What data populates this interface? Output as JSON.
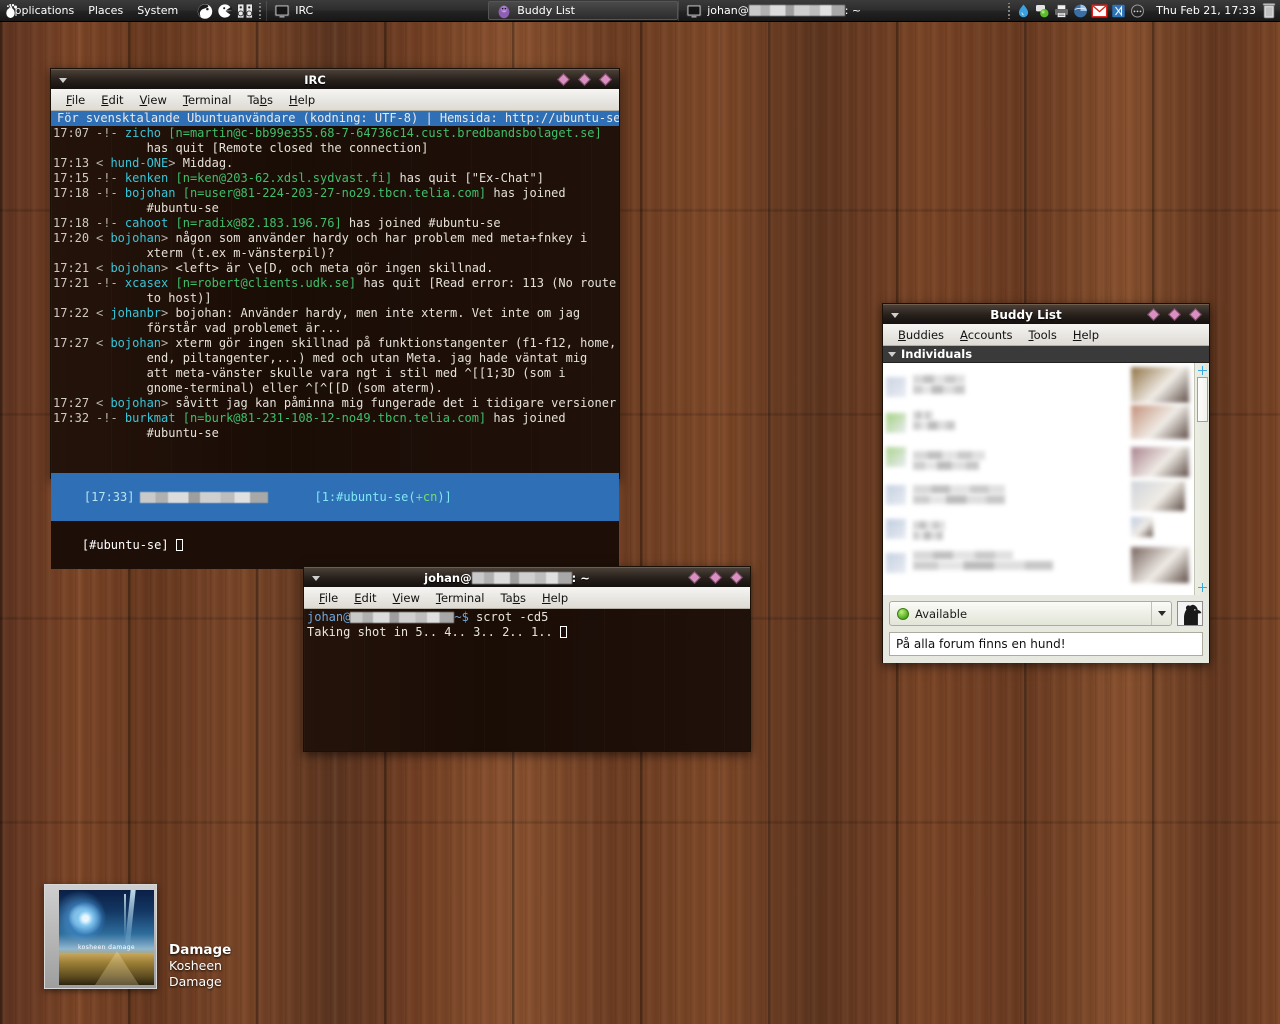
{
  "panel": {
    "foot_icon": "gnome-foot-icon",
    "menus": [
      "Applications",
      "Places",
      "System"
    ],
    "launchers": [
      {
        "name": "firefox-icon"
      },
      {
        "name": "pidgin-icon"
      },
      {
        "name": "volume-control-icon"
      }
    ],
    "tasks": [
      {
        "name": "task-irc",
        "icon": "terminal-icon",
        "label": "IRC",
        "active": false
      },
      {
        "name": "task-buddy-list",
        "icon": "pidgin-icon",
        "label": "Buddy List",
        "active": true
      },
      {
        "name": "task-terminal",
        "icon": "terminal-icon",
        "label": "johan@",
        "label_suffix": ": ~",
        "redacted": true,
        "active": false
      }
    ],
    "tray": [
      {
        "name": "deluge-tray-icon"
      },
      {
        "name": "chat-tray-icon"
      },
      {
        "name": "printer-tray-icon"
      },
      {
        "name": "update-manager-tray-icon"
      },
      {
        "name": "gmail-notifier-tray-icon"
      },
      {
        "name": "blueman-tray-icon"
      },
      {
        "name": "network-tray-icon"
      }
    ],
    "clock": "Thu Feb 21, 17:33",
    "trash_icon": "trash-icon"
  },
  "irc_window": {
    "title": "IRC",
    "menus": [
      "File",
      "Edit",
      "View",
      "Terminal",
      "Tabs",
      "Help"
    ],
    "topic": "För svensktalande Ubuntuanvändare (kodning: UTF-8) | Hemsida: http://ubuntu-se",
    "lines": [
      {
        "ts": "17:07",
        "type": "event",
        "marker": "-!-",
        "nick": "zicho",
        "host": "[n=martin@c-bb99e355.68-7-64736c14.cust.bredbandsbolaget.se]",
        "text": ""
      },
      {
        "ts": "",
        "type": "cont",
        "text": "has quit [Remote closed the connection]"
      },
      {
        "ts": "17:13",
        "type": "msg",
        "nick": "hund-ONE",
        "text": "Middag."
      },
      {
        "ts": "17:15",
        "type": "event",
        "marker": "-!-",
        "nick": "kenken",
        "host": "[n=ken@203-62.xdsl.sydvast.fi]",
        "text": "has quit [\"Ex-Chat\"]"
      },
      {
        "ts": "17:18",
        "type": "event",
        "marker": "-!-",
        "nick": "bojohan",
        "host": "[n=user@81-224-203-27-no29.tbcn.telia.com]",
        "text": "has joined"
      },
      {
        "ts": "",
        "type": "cont",
        "text": "#ubuntu-se"
      },
      {
        "ts": "17:18",
        "type": "event",
        "marker": "-!-",
        "nick": "cahoot",
        "host": "[n=radix@82.183.196.76]",
        "text": "has joined #ubuntu-se"
      },
      {
        "ts": "17:20",
        "type": "msg",
        "nick": "bojohan",
        "text": "någon som använder hardy och har problem med meta+fnkey i"
      },
      {
        "ts": "",
        "type": "cont",
        "text": "xterm (t.ex m-vänsterpil)?"
      },
      {
        "ts": "17:21",
        "type": "msg",
        "nick": "bojohan",
        "text": "<left> är \\e[D, och meta gör ingen skillnad."
      },
      {
        "ts": "17:21",
        "type": "event",
        "marker": "-!-",
        "nick": "xcasex",
        "host": "[n=robert@clients.udk.se]",
        "text": "has quit [Read error: 113 (No route"
      },
      {
        "ts": "",
        "type": "cont",
        "text": "to host)]"
      },
      {
        "ts": "17:22",
        "type": "msg",
        "nick": "johanbr",
        "text": "bojohan: Använder hardy, men inte xterm. Vet inte om jag"
      },
      {
        "ts": "",
        "type": "cont",
        "text": "förstår vad problemet är..."
      },
      {
        "ts": "17:27",
        "type": "msg",
        "nick": "bojohan",
        "text": "xterm gör ingen skillnad på funktionstangenter (f1-f12, home,"
      },
      {
        "ts": "",
        "type": "cont",
        "text": "end, piltangenter,...) med och utan Meta. jag hade väntat mig"
      },
      {
        "ts": "",
        "type": "cont",
        "text": "att meta-vänster skulle vara ngt i stil med ^[[1;3D (som i"
      },
      {
        "ts": "",
        "type": "cont",
        "text": "gnome-terminal) eller ^[^[[D (som aterm)."
      },
      {
        "ts": "17:27",
        "type": "msg",
        "nick": "bojohan",
        "text": "såvitt jag kan påminna mig fungerade det i tidigare versioner."
      },
      {
        "ts": "17:32",
        "type": "event",
        "marker": "-!-",
        "nick": "burkmat",
        "host": "[n=burk@81-231-108-12-no49.tbcn.telia.com]",
        "text": "has joined"
      },
      {
        "ts": "",
        "type": "cont",
        "text": "#ubuntu-se"
      }
    ],
    "status": {
      "ts": "[17:33]",
      "nick_redacted": true,
      "channel": "[1:#ubuntu-se(",
      "mode": "+cn",
      "channel_end": ")]"
    },
    "input_prompt": "[#ubuntu-se]"
  },
  "terminal_window": {
    "title_user": "johan@",
    "title_suffix": ": ~",
    "menus": [
      "File",
      "Edit",
      "View",
      "Terminal",
      "Tabs",
      "Help"
    ],
    "prompt_user": "johan@",
    "prompt_tail": "~$ ",
    "command": "scrot -cd5",
    "output": "Taking shot in 5.. 4.. 3.. 2.. 1.. "
  },
  "buddy_window": {
    "title": "Buddy List",
    "menus": [
      "Buddies",
      "Accounts",
      "Tools",
      "Help"
    ],
    "group_label": "Individuals",
    "buddy_count_visible": 6,
    "status": {
      "label": "Available",
      "dot_color": "#4fa91f"
    },
    "status_message": "På alla forum finns en hund!",
    "avatar_icon": "dog-avatar-icon"
  },
  "osd": {
    "title": "Damage",
    "artist": "Kosheen",
    "album": "Damage",
    "art_caption": "kosheen damage"
  }
}
